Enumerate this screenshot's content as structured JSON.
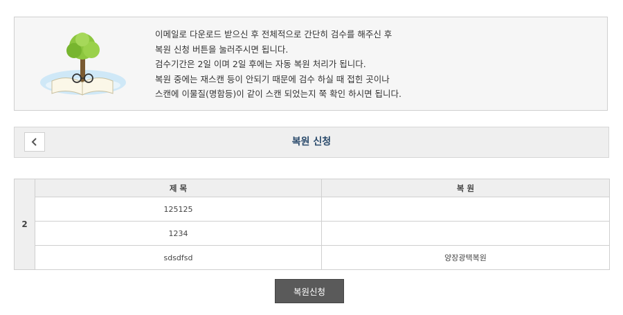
{
  "notice": {
    "illustration": "book-tree-glasses-illustration",
    "lines": [
      "이메일로 다운로드 받으신 후 전체적으로 간단히 검수를 해주신 후",
      "복원 신청 버튼을 눌러주시면 됩니다.",
      "검수기간은 2일 이며 2일 후에는 자동 복원 처리가 됩니다.",
      "복원 중에는 재스캔 등이 안되기 때문에 검수 하실 때 접힌 곳이나",
      "스캔에 이물질(명함등)이 같이 스캔 되었는지 쭉 확인 하시면 됩니다."
    ]
  },
  "titlebar": {
    "back_icon": "chevron-left-icon",
    "title": "복원 신청"
  },
  "table": {
    "headers": [
      "제 목",
      "복 원"
    ],
    "group_number": "2",
    "rows": [
      {
        "title": "125125",
        "restore": ""
      },
      {
        "title": "1234",
        "restore": ""
      },
      {
        "title": "sdsdfsd",
        "restore": "양장광택복원"
      }
    ]
  },
  "actions": {
    "apply_label": "복원신청"
  }
}
